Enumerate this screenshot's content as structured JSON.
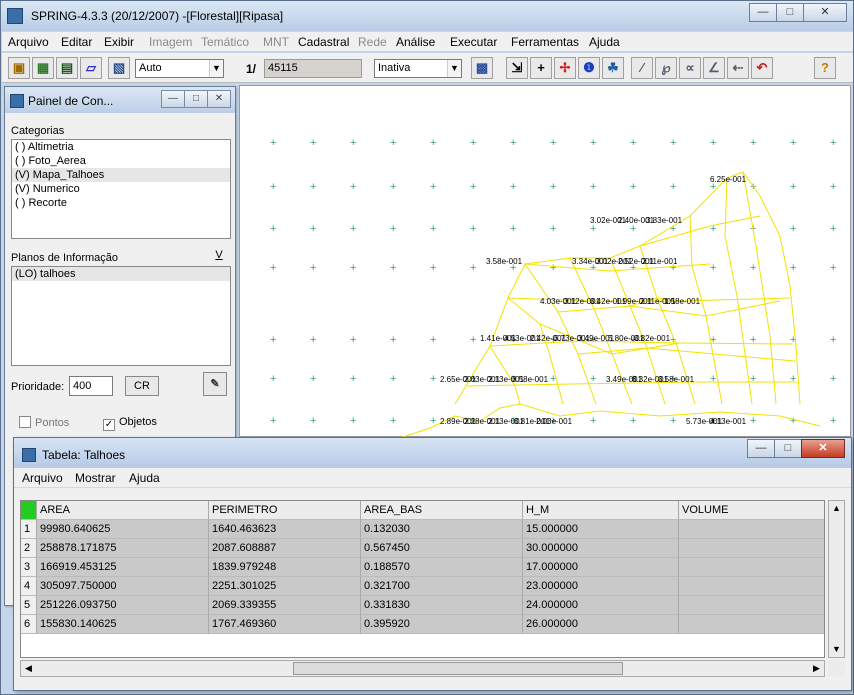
{
  "app": {
    "title": "SPRING-4.3.3 (20/12/2007) -[Florestal][Ripasa]"
  },
  "menubar": {
    "items": [
      {
        "label": "Arquivo",
        "enabled": true
      },
      {
        "label": "Editar",
        "enabled": true
      },
      {
        "label": "Exibir",
        "enabled": true
      },
      {
        "label": "Imagem",
        "enabled": false
      },
      {
        "label": "Temático",
        "enabled": false
      },
      {
        "label": "MNT",
        "enabled": false
      },
      {
        "label": "Cadastral",
        "enabled": true
      },
      {
        "label": "Rede",
        "enabled": false
      },
      {
        "label": "Análise",
        "enabled": true
      },
      {
        "label": "Executar",
        "enabled": true
      },
      {
        "label": "Ferramentas",
        "enabled": true
      },
      {
        "label": "Ajuda",
        "enabled": true
      }
    ]
  },
  "toolbar": {
    "mode_select": "Auto",
    "scale_label": "1/",
    "scale_value": "45115",
    "state_select": "Inativa"
  },
  "canvas": {
    "labels": [
      "6.25e-001",
      "3.02e-001",
      "2.40e-001",
      "3.83e-001",
      "3.58e-001",
      "3.34e-001",
      "3.02e-001",
      "2.52e-001",
      "2.11e-001",
      "4.03e-001",
      "3.12e-001",
      "3.42e-001",
      "1.99e-001",
      "2.11e-001",
      "1.58e-001",
      "1.41e-001",
      "4.53e-001",
      "2.42e-001",
      "5.73e-001",
      "3.49e-001",
      "5.80e-001",
      "3.82e-001",
      "2.65e-001",
      "2.03e-001",
      "2.13e-001",
      "3.58e-001",
      "3.49e-001",
      "3.32e-001",
      "3.58e-001",
      "2.89e-001",
      "2.28e-001",
      "2.13e-001",
      "3.81e-001",
      "2.03e-001",
      "5.73e-001",
      "4.13e-001"
    ]
  },
  "painel": {
    "title": "Painel de Con...",
    "categorias_label": "Categorias",
    "categorias": [
      {
        "label": "( ) Altimetria",
        "selected": false
      },
      {
        "label": "( ) Foto_Aerea",
        "selected": false
      },
      {
        "label": "(V) Mapa_Talhoes",
        "selected": true
      },
      {
        "label": "(V) Numerico",
        "selected": false
      },
      {
        "label": "( ) Recorte",
        "selected": false
      }
    ],
    "planos_label": "Planos de Informação",
    "planos_btn": "V",
    "planos": [
      {
        "label": "(LO) talhoes",
        "selected": true
      }
    ],
    "prioridade_label": "Prioridade:",
    "prioridade_value": "400",
    "cr_label": "CR",
    "pontos_label": "Pontos",
    "objetos_label": "Objetos"
  },
  "tabela": {
    "title": "Tabela: Talhoes",
    "menu": [
      "Arquivo",
      "Mostrar",
      "Ajuda"
    ],
    "columns": [
      "AREA",
      "PERIMETRO",
      "AREA_BAS",
      "H_M",
      "VOLUME"
    ],
    "rows": [
      {
        "num": "1",
        "cells": [
          "99980.640625",
          "1640.463623",
          "0.132030",
          "15.000000",
          ""
        ]
      },
      {
        "num": "2",
        "cells": [
          "258878.171875",
          "2087.608887",
          "0.567450",
          "30.000000",
          ""
        ]
      },
      {
        "num": "3",
        "cells": [
          "166919.453125",
          "1839.979248",
          "0.188570",
          "17.000000",
          ""
        ]
      },
      {
        "num": "4",
        "cells": [
          "305097.750000",
          "2251.301025",
          "0.321700",
          "23.000000",
          ""
        ]
      },
      {
        "num": "5",
        "cells": [
          "251226.093750",
          "2069.339355",
          "0.331830",
          "24.000000",
          ""
        ]
      },
      {
        "num": "6",
        "cells": [
          "155830.140625",
          "1767.469360",
          "0.395920",
          "26.000000",
          ""
        ]
      }
    ]
  },
  "colors": {
    "map_lines": "#f2e200",
    "grid_cross": "#2c9e86",
    "selected_cell": "#22cc22"
  }
}
